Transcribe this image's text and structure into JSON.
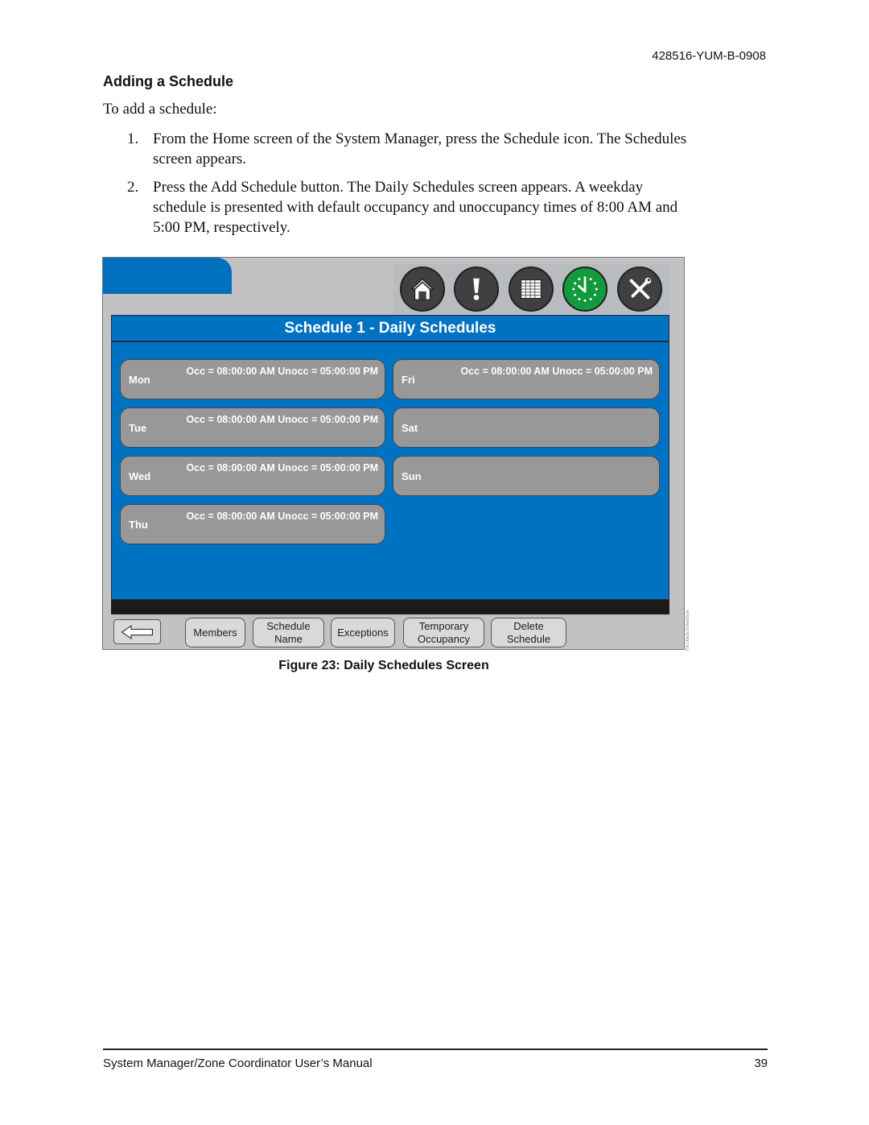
{
  "header": {
    "doc_id": "428516-YUM-B-0908"
  },
  "section": {
    "heading": "Adding a Schedule",
    "intro": "To add a schedule:",
    "steps": [
      {
        "num": "1.",
        "text": "From the Home screen of the System Manager, press the Schedule icon. The Schedules screen appears."
      },
      {
        "num": "2.",
        "text": "Press the Add Schedule button. The Daily Schedules screen appears. A weekday schedule is presented with default occupancy and unoccupancy times of 8:00 AM and 5:00 PM, respectively."
      }
    ]
  },
  "screen": {
    "nav_icons": [
      {
        "name": "home-icon"
      },
      {
        "name": "alarm-icon"
      },
      {
        "name": "grid-icon"
      },
      {
        "name": "clock-icon",
        "active": true,
        "color": "#129a3c"
      },
      {
        "name": "tools-icon"
      }
    ],
    "title": "Schedule 1 - Daily Schedules",
    "days": [
      {
        "day": "Mon",
        "schedule": "Occ = 08:00:00 AM Unocc = 05:00:00 PM"
      },
      {
        "day": "Tue",
        "schedule": "Occ = 08:00:00 AM Unocc = 05:00:00 PM"
      },
      {
        "day": "Wed",
        "schedule": "Occ = 08:00:00 AM Unocc = 05:00:00 PM"
      },
      {
        "day": "Thu",
        "schedule": "Occ = 08:00:00 AM Unocc = 05:00:00 PM"
      },
      {
        "day": "Fri",
        "schedule": "Occ = 08:00:00 AM Unocc = 05:00:00 PM"
      },
      {
        "day": "Sat",
        "schedule": ""
      },
      {
        "day": "Sun",
        "schedule": ""
      }
    ],
    "buttons": {
      "back": "back-arrow-icon",
      "members": "Members",
      "schedule_name_1": "Schedule",
      "schedule_name_2": "Name",
      "exceptions": "Exceptions",
      "temporary_occupancy_1": "Temporary",
      "temporary_occupancy_2": "Occupancy",
      "delete_schedule_1": "Delete",
      "delete_schedule_2": "Schedule"
    },
    "colors": {
      "panel_blue": "#0072c2",
      "day_gray": "#989898",
      "frame_gray": "#c2c2c2"
    }
  },
  "figure": {
    "tag": "FIG:DailySchedScrn",
    "caption": "Figure 23: Daily Schedules Screen"
  },
  "footer": {
    "title": "System Manager/Zone Coordinator User’s Manual",
    "page": "39"
  }
}
